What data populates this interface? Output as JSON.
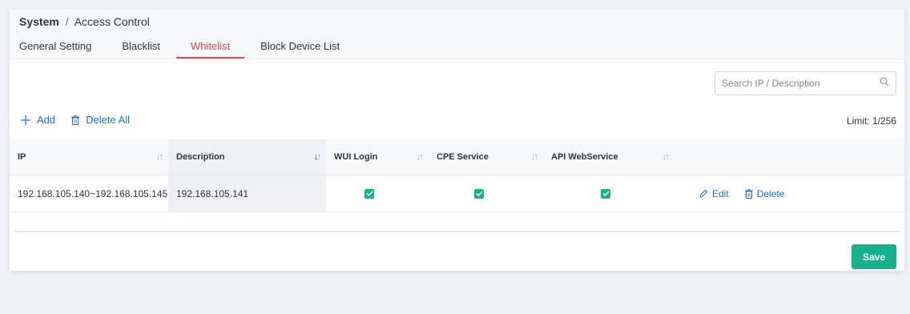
{
  "breadcrumb": {
    "section": "System",
    "separator": "/",
    "page": "Access Control"
  },
  "tabs": [
    {
      "label": "General Setting",
      "active": false
    },
    {
      "label": "Blacklist",
      "active": false
    },
    {
      "label": "Whitelist",
      "active": true
    },
    {
      "label": "Block Device List",
      "active": false
    }
  ],
  "search": {
    "placeholder": "Search IP / Description",
    "value": "",
    "icon": "search-icon"
  },
  "toolbar": {
    "add_label": "Add",
    "delete_all_label": "Delete All",
    "limit_text": "Limit: 1/256"
  },
  "table": {
    "columns": [
      {
        "label": "IP",
        "sort": "none"
      },
      {
        "label": "Description",
        "sort": "desc"
      },
      {
        "label": "WUI Login",
        "sort": "none"
      },
      {
        "label": "CPE Service",
        "sort": "none"
      },
      {
        "label": "API WebService",
        "sort": "none"
      }
    ],
    "rows": [
      {
        "ip": "192.168.105.140~192.168.105.145",
        "description": "192.168.105.141",
        "wui_login": true,
        "cpe_service": true,
        "api_webservice": true,
        "edit_label": "Edit",
        "delete_label": "Delete"
      }
    ]
  },
  "save_label": "Save",
  "colors": {
    "accent_tab": "#e0444d",
    "link": "#1f6fc5",
    "primary_button": "#16b28e",
    "checkbox": "#16b28e"
  }
}
